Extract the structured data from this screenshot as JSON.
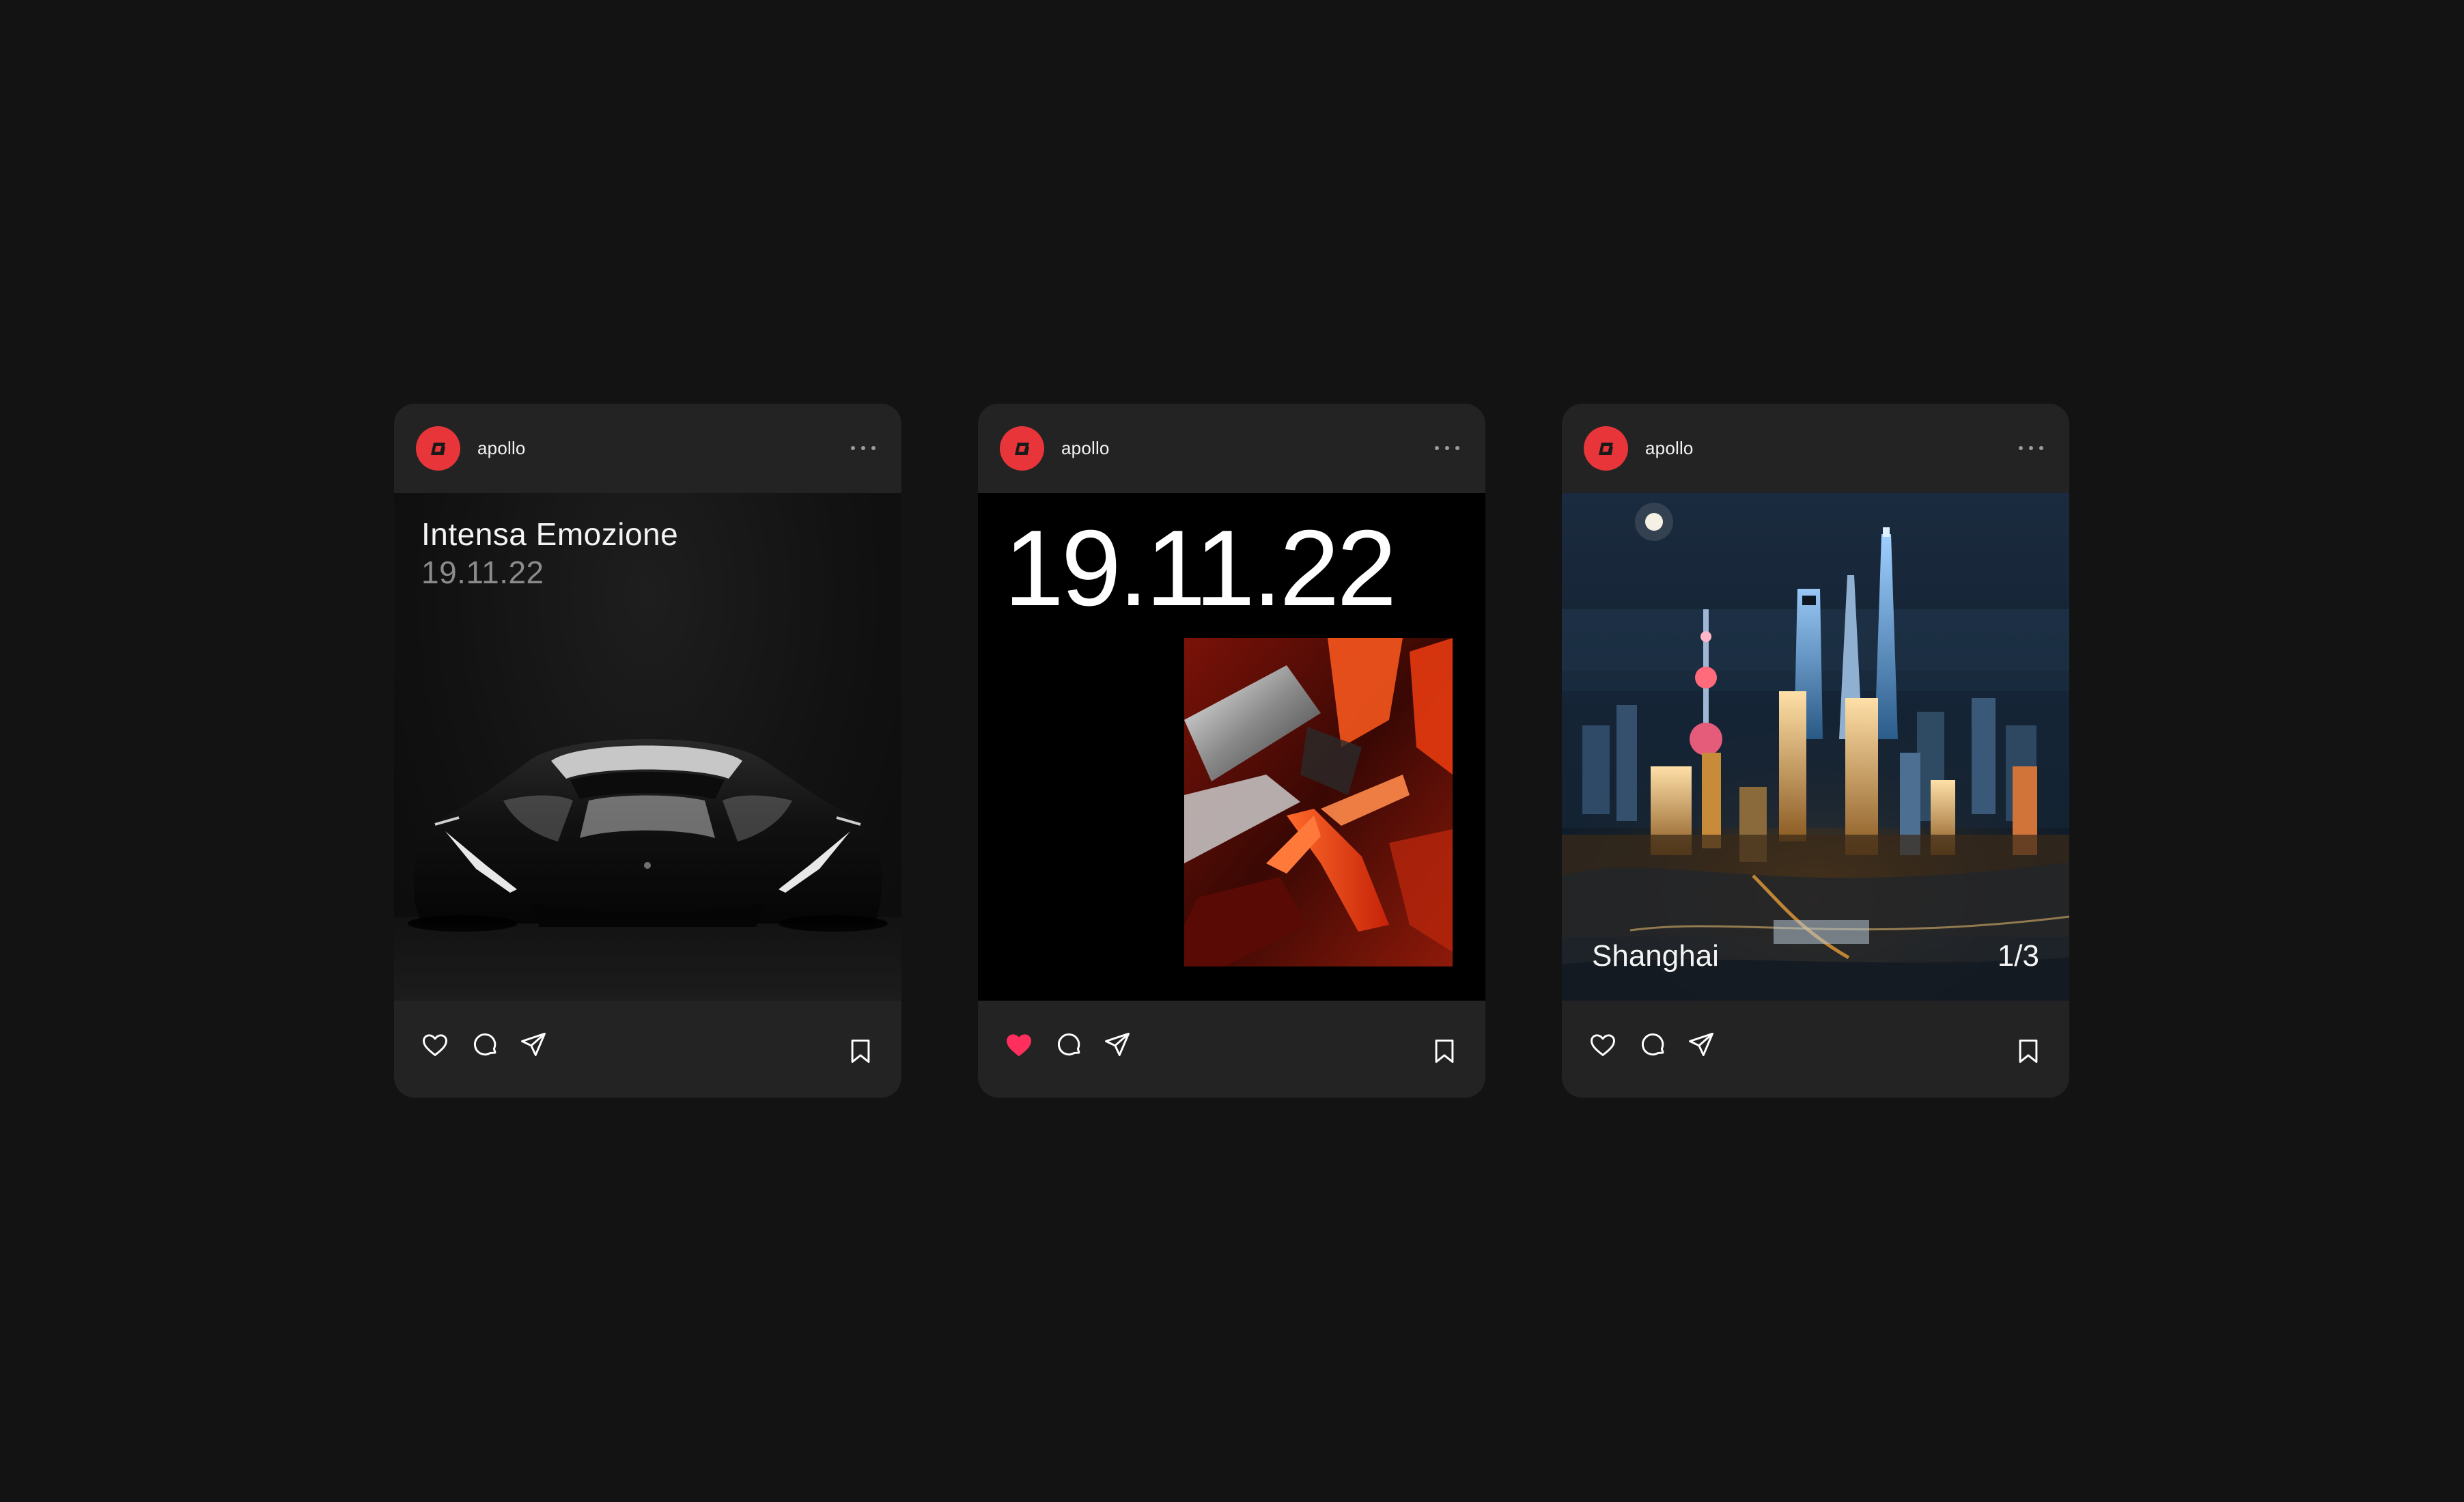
{
  "accent_color": "#e8353a",
  "like_active_color": "#ff2f5d",
  "posts": [
    {
      "username": "apollo",
      "avatar_icon": "apollo-logo-icon",
      "title": "Intensa Emozione",
      "subtitle": "19.11.22",
      "image": "supercar-front-view",
      "liked": false,
      "actions": [
        "heart-icon",
        "comment-icon",
        "send-icon",
        "bookmark-icon"
      ]
    },
    {
      "username": "apollo",
      "avatar_icon": "apollo-logo-icon",
      "big_date": "19.11.22",
      "image": "red-abstract-carbon-detail",
      "liked": true,
      "actions": [
        "heart-icon",
        "comment-icon",
        "send-icon",
        "bookmark-icon"
      ]
    },
    {
      "username": "apollo",
      "avatar_icon": "apollo-logo-icon",
      "caption": "Shanghai",
      "page_indicator": "1/3",
      "image": "shanghai-skyline-night",
      "liked": false,
      "actions": [
        "heart-icon",
        "comment-icon",
        "send-icon",
        "bookmark-icon"
      ]
    }
  ]
}
